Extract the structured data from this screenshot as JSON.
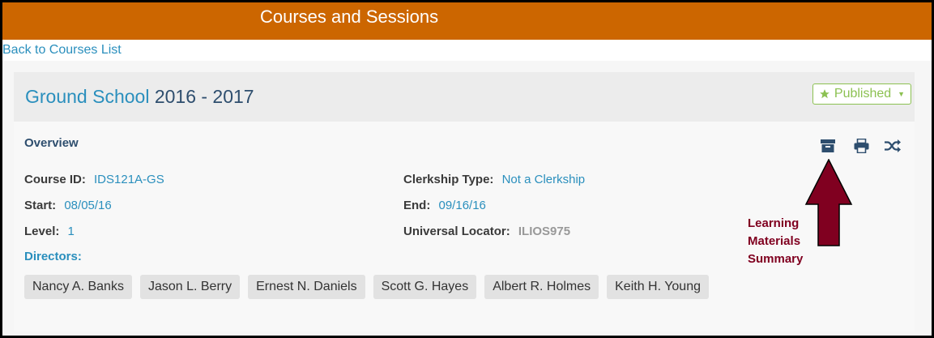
{
  "header": {
    "title": "Courses and Sessions"
  },
  "nav": {
    "back_link": "Back to Courses List"
  },
  "course": {
    "name": "Ground School",
    "year": "2016 - 2017",
    "status": "Published"
  },
  "overview": {
    "label": "Overview",
    "fields": {
      "course_id": {
        "label": "Course ID:",
        "value": "IDS121A-GS"
      },
      "clerkship_type": {
        "label": "Clerkship Type:",
        "value": "Not a Clerkship"
      },
      "start": {
        "label": "Start:",
        "value": "08/05/16"
      },
      "end": {
        "label": "End:",
        "value": "09/16/16"
      },
      "level": {
        "label": "Level:",
        "value": "1"
      },
      "universal_locator": {
        "label": "Universal Locator:",
        "value": "ILIOS975"
      }
    },
    "directors_label": "Directors:",
    "directors": [
      "Nancy A. Banks",
      "Jason L. Berry",
      "Ernest N. Daniels",
      "Scott G. Hayes",
      "Albert R. Holmes",
      "Keith H. Young"
    ]
  },
  "annotation": {
    "line1": "Learning",
    "line2": "Materials",
    "line3": "Summary"
  },
  "icons": [
    "archive-icon",
    "print-icon",
    "shuffle-icon",
    "star-icon",
    "caret-down-icon"
  ],
  "colors": {
    "header_bg": "#cc6600",
    "link": "#2a8fbd",
    "published": "#8cc152",
    "annotation": "#800020"
  }
}
